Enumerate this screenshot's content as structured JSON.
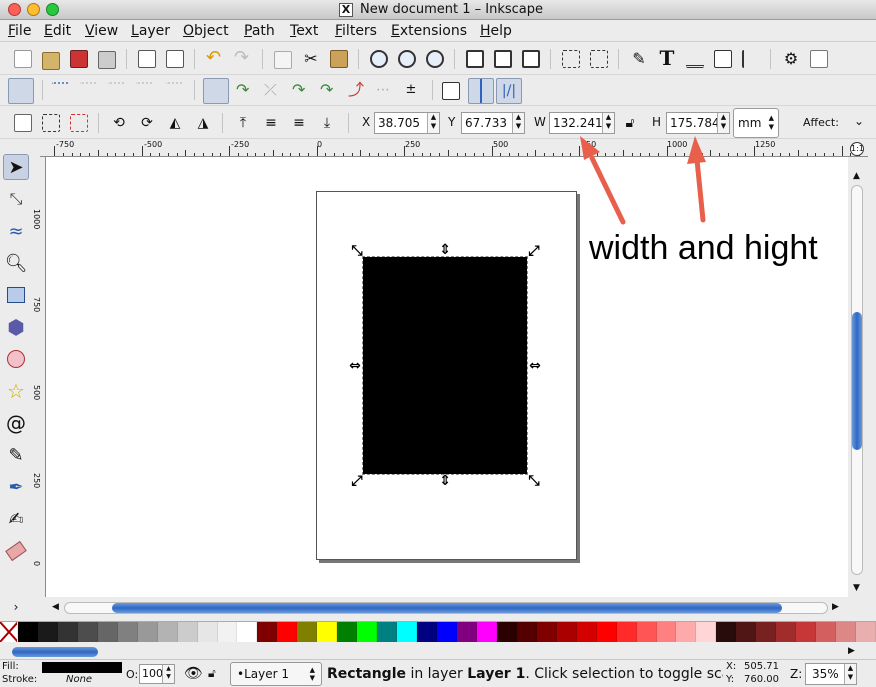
{
  "window": {
    "title": "New document 1 – Inkscape",
    "x11_glyph": "X",
    "traffic_lights": [
      "#ff5f57",
      "#ffbd2e",
      "#28c940"
    ]
  },
  "menu": [
    "File",
    "Edit",
    "View",
    "Layer",
    "Object",
    "Path",
    "Text",
    "Filters",
    "Extensions",
    "Help"
  ],
  "toolbar_commands": {
    "icons": [
      "new-document-icon",
      "open-icon",
      "save-icon",
      "print-icon",
      "import-icon",
      "export-icon",
      "undo-icon",
      "redo-icon",
      "copy-icon",
      "cut-icon",
      "paste-icon",
      "zoom-selection-icon",
      "zoom-drawing-icon",
      "zoom-page-icon",
      "duplicate-icon",
      "clone-icon",
      "unlink-clone-icon",
      "group-icon",
      "ungroup-icon",
      "fill-stroke-icon",
      "text-font-icon",
      "layers-icon",
      "xml-editor-icon",
      "align-icon",
      "preferences-icon",
      "document-properties-icon"
    ],
    "text_icon_glyph": "T"
  },
  "snap_toolbar": {
    "icons": [
      "snap-toggle-icon",
      "snap-bbox-icon",
      "snap-bbox-edge-icon",
      "snap-bbox-corner-icon",
      "snap-bbox-midpoint-icon",
      "snap-nodes-icon",
      "snap-path-icon",
      "snap-path-intersection-icon",
      "snap-cusp-icon",
      "snap-smooth-icon",
      "snap-midpoint-icon",
      "snap-center-icon",
      "snap-page-icon",
      "snap-grid-icon",
      "snap-guide-icon"
    ],
    "midpoint_glyph": "±"
  },
  "select_toolbar": {
    "x": {
      "label": "X",
      "value": "38.705"
    },
    "y": {
      "label": "Y",
      "value": "67.733"
    },
    "w": {
      "label": "W",
      "value": "132.241"
    },
    "h": {
      "label": "H",
      "value": "175.784"
    },
    "unit": "mm",
    "affect_label": "Affect:"
  },
  "ruler": {
    "labels": [
      "-750",
      "-500",
      "-250",
      "0",
      "250",
      "500",
      "750",
      "1000",
      "1250"
    ]
  },
  "vruler": {
    "labels": [
      "1000",
      "750",
      "500",
      "250",
      "0"
    ]
  },
  "tools": [
    "selector-tool-icon",
    "node-tool-icon",
    "tweak-tool-icon",
    "zoom-tool-icon",
    "rectangle-tool-icon",
    "3d-box-tool-icon",
    "ellipse-tool-icon",
    "star-tool-icon",
    "spiral-tool-icon",
    "pencil-tool-icon",
    "pen-tool-icon",
    "calligraphy-tool-icon",
    "eraser-tool-icon"
  ],
  "annotation": {
    "text": "width and hight",
    "color": "#e8604c"
  },
  "palette": [
    "#000000",
    "#1a1a1a",
    "#333333",
    "#4d4d4d",
    "#666666",
    "#808080",
    "#999999",
    "#b3b3b3",
    "#cccccc",
    "#e6e6e6",
    "#f2f2f2",
    "#ffffff",
    "#800000",
    "#ff0000",
    "#808000",
    "#ffff00",
    "#008000",
    "#00ff00",
    "#008080",
    "#00ffff",
    "#000080",
    "#0000ff",
    "#800080",
    "#ff00ff",
    "#2b0000",
    "#550000",
    "#800000",
    "#aa0000",
    "#d40000",
    "#ff0000",
    "#ff2a2a",
    "#ff5555",
    "#ff8080",
    "#ffaaaa",
    "#ffd5d5",
    "#280b0b",
    "#501616",
    "#782121",
    "#a02c2c",
    "#c83737",
    "#d35f5f",
    "#de8787",
    "#e9afaf"
  ],
  "status": {
    "fill_label": "Fill:",
    "stroke_label": "Stroke:",
    "stroke_value": "None",
    "opacity_label": "O:",
    "opacity_value": "100",
    "layer": "•Layer 1",
    "message_bold": "Rectangle",
    "message_mid": " in layer ",
    "message_bold2": "Layer 1",
    "message_tail": ". Click selection to toggle scal.",
    "cursor_x_label": "X:",
    "cursor_x": "505.71",
    "cursor_y_label": "Y:",
    "cursor_y": "760.00",
    "zoom_label": "Z:",
    "zoom": "35%"
  }
}
